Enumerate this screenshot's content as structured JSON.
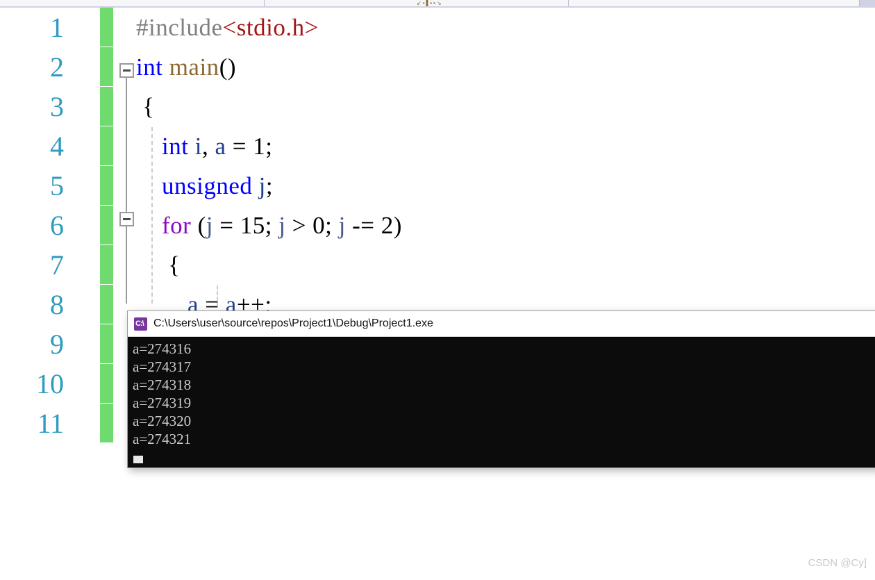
{
  "window": {
    "top_chrome_glyphs": "↙ ▪ ▌▪ ▪ ↘"
  },
  "editor": {
    "line_numbers": [
      "1",
      "2",
      "3",
      "4",
      "5",
      "6",
      "7",
      "8",
      "9",
      "10",
      "11"
    ],
    "code_lines": [
      {
        "n": 1,
        "tokens": [
          {
            "t": "#include",
            "c": "tok-pre"
          },
          {
            "t": "<stdio.h>",
            "c": "tok-header"
          }
        ]
      },
      {
        "n": 2,
        "tokens": [
          {
            "t": "int",
            "c": "tok-keyword"
          },
          {
            "t": " ",
            "c": "tok-plain"
          },
          {
            "t": "main",
            "c": "tok-func"
          },
          {
            "t": "()",
            "c": "tok-plain"
          }
        ]
      },
      {
        "n": 3,
        "tokens": [
          {
            "t": " {",
            "c": "tok-plain"
          }
        ]
      },
      {
        "n": 4,
        "tokens": [
          {
            "t": "    ",
            "c": "tok-plain"
          },
          {
            "t": "int",
            "c": "tok-keyword"
          },
          {
            "t": " ",
            "c": "tok-plain"
          },
          {
            "t": "i",
            "c": "tok-var"
          },
          {
            "t": ", ",
            "c": "tok-plain"
          },
          {
            "t": "a",
            "c": "tok-var"
          },
          {
            "t": " = ",
            "c": "tok-plain"
          },
          {
            "t": "1",
            "c": "tok-num"
          },
          {
            "t": ";",
            "c": "tok-plain"
          }
        ]
      },
      {
        "n": 5,
        "tokens": [
          {
            "t": "    ",
            "c": "tok-plain"
          },
          {
            "t": "unsigned",
            "c": "tok-keyword"
          },
          {
            "t": " ",
            "c": "tok-plain"
          },
          {
            "t": "j",
            "c": "tok-var"
          },
          {
            "t": ";",
            "c": "tok-plain"
          }
        ]
      },
      {
        "n": 6,
        "tokens": [
          {
            "t": "    ",
            "c": "tok-plain"
          },
          {
            "t": "for",
            "c": "tok-kw-ctrl"
          },
          {
            "t": " (",
            "c": "tok-plain"
          },
          {
            "t": "j",
            "c": "tok-ident"
          },
          {
            "t": " = ",
            "c": "tok-plain"
          },
          {
            "t": "15",
            "c": "tok-num"
          },
          {
            "t": "; ",
            "c": "tok-plain"
          },
          {
            "t": "j",
            "c": "tok-ident"
          },
          {
            "t": " > ",
            "c": "tok-plain"
          },
          {
            "t": "0",
            "c": "tok-num"
          },
          {
            "t": "; ",
            "c": "tok-plain"
          },
          {
            "t": "j",
            "c": "tok-ident"
          },
          {
            "t": " -= ",
            "c": "tok-plain"
          },
          {
            "t": "2",
            "c": "tok-num"
          },
          {
            "t": ")",
            "c": "tok-plain"
          }
        ]
      },
      {
        "n": 7,
        "tokens": [
          {
            "t": "     {",
            "c": "tok-plain"
          }
        ]
      },
      {
        "n": 8,
        "tokens": [
          {
            "t": "        ",
            "c": "tok-plain"
          },
          {
            "t": "a",
            "c": "tok-var"
          },
          {
            "t": " = ",
            "c": "tok-plain"
          },
          {
            "t": "a",
            "c": "tok-var"
          },
          {
            "t": "++;",
            "c": "tok-plain"
          }
        ]
      }
    ]
  },
  "console": {
    "title": "C:\\Users\\user\\source\\repos\\Project1\\Debug\\Project1.exe",
    "icon_label": "C:\\",
    "output_lines": [
      "a=274316",
      "a=274317",
      "a=274318",
      "a=274319",
      "a=274320",
      "a=274321"
    ]
  },
  "watermark": {
    "text": "CSDN @Cy]"
  },
  "colors": {
    "change_bar_green": "#6fdb6f",
    "line_number_blue": "#2e9bc0",
    "keyword_blue": "#0000ff",
    "control_purple": "#8f08c4",
    "header_red": "#a31515",
    "function_tan": "#8a6a30",
    "console_bg": "#0c0c0c",
    "console_text": "#cccccc",
    "chrome_lavender": "#cfd1e4"
  }
}
